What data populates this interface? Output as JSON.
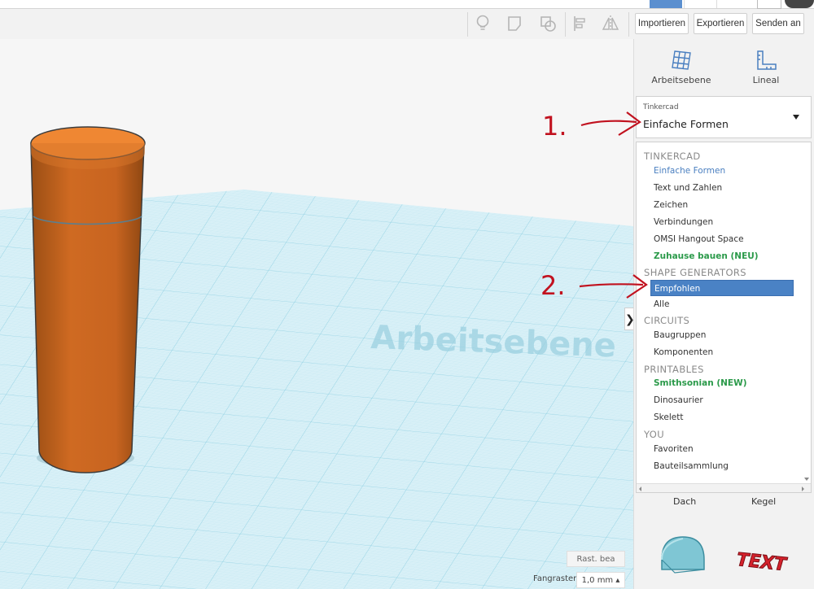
{
  "toolbar": {
    "icons": [
      "lightbulb-icon",
      "note-icon",
      "group-icon",
      "align-icon",
      "mirror-icon"
    ],
    "import_label": "Importieren",
    "export_label": "Exportieren",
    "send_label": "Senden an"
  },
  "panel": {
    "workplane_label": "Arbeitsebene",
    "ruler_label": "Lineal",
    "dropdown": {
      "category": "Tinkercad",
      "selected": "Einfache Formen"
    },
    "groups": [
      {
        "title": "TINKERCAD",
        "items": [
          "Einfache Formen",
          "Text und Zahlen",
          "Zeichen",
          "Verbindungen",
          "OMSI Hangout Space",
          "Zuhause bauen (NEU)"
        ]
      },
      {
        "title": "SHAPE GENERATORS",
        "items": [
          "Empfohlen",
          "Alle"
        ]
      },
      {
        "title": "CIRCUITS",
        "items": [
          "Baugruppen",
          "Komponenten"
        ]
      },
      {
        "title": "PRINTABLES",
        "items": [
          "Smithsonian (NEW)",
          "Dinosaurier",
          "Skelett"
        ]
      },
      {
        "title": "YOU",
        "items": [
          "Favoriten",
          "Bauteilsammlung"
        ]
      }
    ],
    "shapes": {
      "left_label": "Dach",
      "right_label": "Kegel",
      "text_shape": "TEXT"
    },
    "toggle_glyph": "❯"
  },
  "viewport": {
    "watermark": "Arbeitsebene",
    "edit_grid_label": "Rast. bea",
    "snap_label": "Fangraster",
    "snap_value": "1,0 mm ▴"
  },
  "annotations": {
    "first": "1.",
    "second": "2."
  },
  "colors": {
    "cylinder": "#e07a2e",
    "grid": "#a9dcea",
    "accent": "#4a82c5",
    "annotation": "#c1121f"
  }
}
